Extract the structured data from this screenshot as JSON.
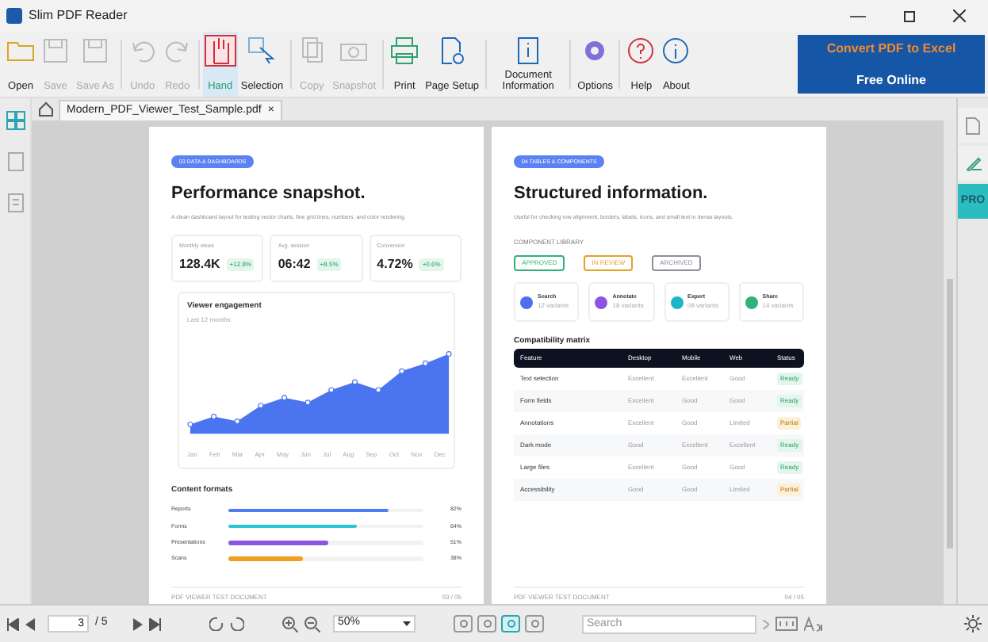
{
  "window": {
    "title": "Slim PDF Reader"
  },
  "toolbar": {
    "groups": [
      [
        {
          "label": "Open",
          "disabled": false,
          "selected": false
        },
        {
          "label": "Save",
          "disabled": true,
          "selected": false
        },
        {
          "label": "Save As",
          "disabled": true,
          "selected": false
        }
      ],
      [
        {
          "label": "Undo",
          "disabled": true,
          "selected": false
        },
        {
          "label": "Redo",
          "disabled": true,
          "selected": false
        }
      ],
      [
        {
          "label": "Hand",
          "disabled": false,
          "selected": true
        },
        {
          "label": "Selection",
          "disabled": false,
          "selected": false
        }
      ],
      [
        {
          "label": "Copy",
          "disabled": true,
          "selected": false
        },
        {
          "label": "Snapshot",
          "disabled": true,
          "selected": false
        }
      ],
      [
        {
          "label": "Print",
          "disabled": false,
          "selected": false
        },
        {
          "label": "Page Setup",
          "disabled": false,
          "selected": false
        }
      ],
      [
        {
          "label": "Document Information",
          "disabled": false,
          "selected": false
        }
      ],
      [
        {
          "label": "Options",
          "disabled": false,
          "selected": false
        }
      ],
      [
        {
          "label": "Help",
          "disabled": false,
          "selected": false
        },
        {
          "label": "About",
          "disabled": false,
          "selected": false
        }
      ]
    ],
    "promo": {
      "line_1": "Convert PDF to Excel",
      "line_2": "Free Online"
    }
  },
  "document_tab": {
    "label": "Modern_PDF_Viewer_Test_Sample.pdf",
    "close": "×"
  },
  "right_sidebar": [
    {
      "kind": "doc",
      "selected": false
    },
    {
      "kind": "sign",
      "selected": false
    },
    {
      "kind": "text",
      "label": "PRO",
      "selected": true
    }
  ],
  "pages": [
    {
      "kind": "dashboard",
      "tag": "03 DATA & DASHBOARDS",
      "title": "Performance snapshot.",
      "subtitle": "A clean dashboard layout for testing vector charts, fine grid lines, numbers, and color rendering.",
      "kpis": [
        {
          "label": "Monthly views",
          "value": "128.4K",
          "delta": "+12.8%"
        },
        {
          "label": "Avg. session",
          "value": "06:42",
          "delta": "+8.5%"
        },
        {
          "label": "Conversion",
          "value": "4.72%",
          "delta": "+0.6%"
        }
      ],
      "chart_title": "Viewer engagement",
      "chart_subtitle": "Last 12 months",
      "months": [
        "Jan",
        "Feb",
        "Mar",
        "Apr",
        "May",
        "Jun",
        "Jul",
        "Aug",
        "Sep",
        "Oct",
        "Nov",
        "Dec"
      ],
      "formats_title": "Content formats",
      "formats": [
        {
          "label": "Reports",
          "level": 0.82,
          "value": "82%",
          "color": "#4f7cf0"
        },
        {
          "label": "Forms",
          "level": 0.66,
          "value": "64%",
          "color": "#2cc4cf"
        },
        {
          "label": "Presentations",
          "level": 0.51,
          "value": "51%",
          "color": "#8b55e0"
        },
        {
          "label": "Scans",
          "level": 0.38,
          "value": "38%",
          "color": "#f0a020"
        }
      ],
      "footer_left": "PDF VIEWER TEST DOCUMENT",
      "footer_right": "03 / 05"
    },
    {
      "kind": "table",
      "tag": "04 TABLES & COMPONENTS",
      "title": "Structured information.",
      "subtitle": "Useful for checking row alignment, borders, labels, icons, and small text in dense layouts.",
      "library_label": "COMPONENT LIBRARY",
      "chips": [
        {
          "label": "APPROVED",
          "color": "#2fb27a"
        },
        {
          "label": "IN REVIEW",
          "color": "#e5a220"
        },
        {
          "label": "ARCHIVED",
          "color": "#8a8f99"
        }
      ],
      "components": [
        {
          "label": "Search",
          "note": "12 variants",
          "color": "#4f6ef0"
        },
        {
          "label": "Annotate",
          "note": "18 variants",
          "color": "#8b55e0"
        },
        {
          "label": "Export",
          "note": "09 variants",
          "color": "#1fb5c9"
        },
        {
          "label": "Share",
          "note": "14 variants",
          "color": "#2fb27a"
        }
      ],
      "table_title": "Compatibility matrix",
      "columns": [
        "Feature",
        "Desktop",
        "Mobile",
        "Web",
        "Status"
      ],
      "rows": [
        [
          "Text selection",
          "Excellent",
          "Excellent",
          "Good",
          "Ready"
        ],
        [
          "Form fields",
          "Excellent",
          "Good",
          "Good",
          "Ready"
        ],
        [
          "Annotations",
          "Excellent",
          "Good",
          "Limited",
          "Partial"
        ],
        [
          "Dark mode",
          "Good",
          "Excellent",
          "Excellent",
          "Ready"
        ],
        [
          "Large files",
          "Excellent",
          "Good",
          "Good",
          "Ready"
        ],
        [
          "Accessibility",
          "Good",
          "Good",
          "Limited",
          "Partial"
        ]
      ],
      "footer_left": "PDF VIEWER TEST DOCUMENT",
      "footer_right": "04 / 05"
    }
  ],
  "bottom_bar": {
    "page": "3",
    "page_total": "/ 5",
    "zoom": "50%",
    "search_placeholder": "Search",
    "view_modes": [
      {
        "selected": false
      },
      {
        "selected": false
      },
      {
        "selected": true
      },
      {
        "selected": false
      }
    ]
  }
}
